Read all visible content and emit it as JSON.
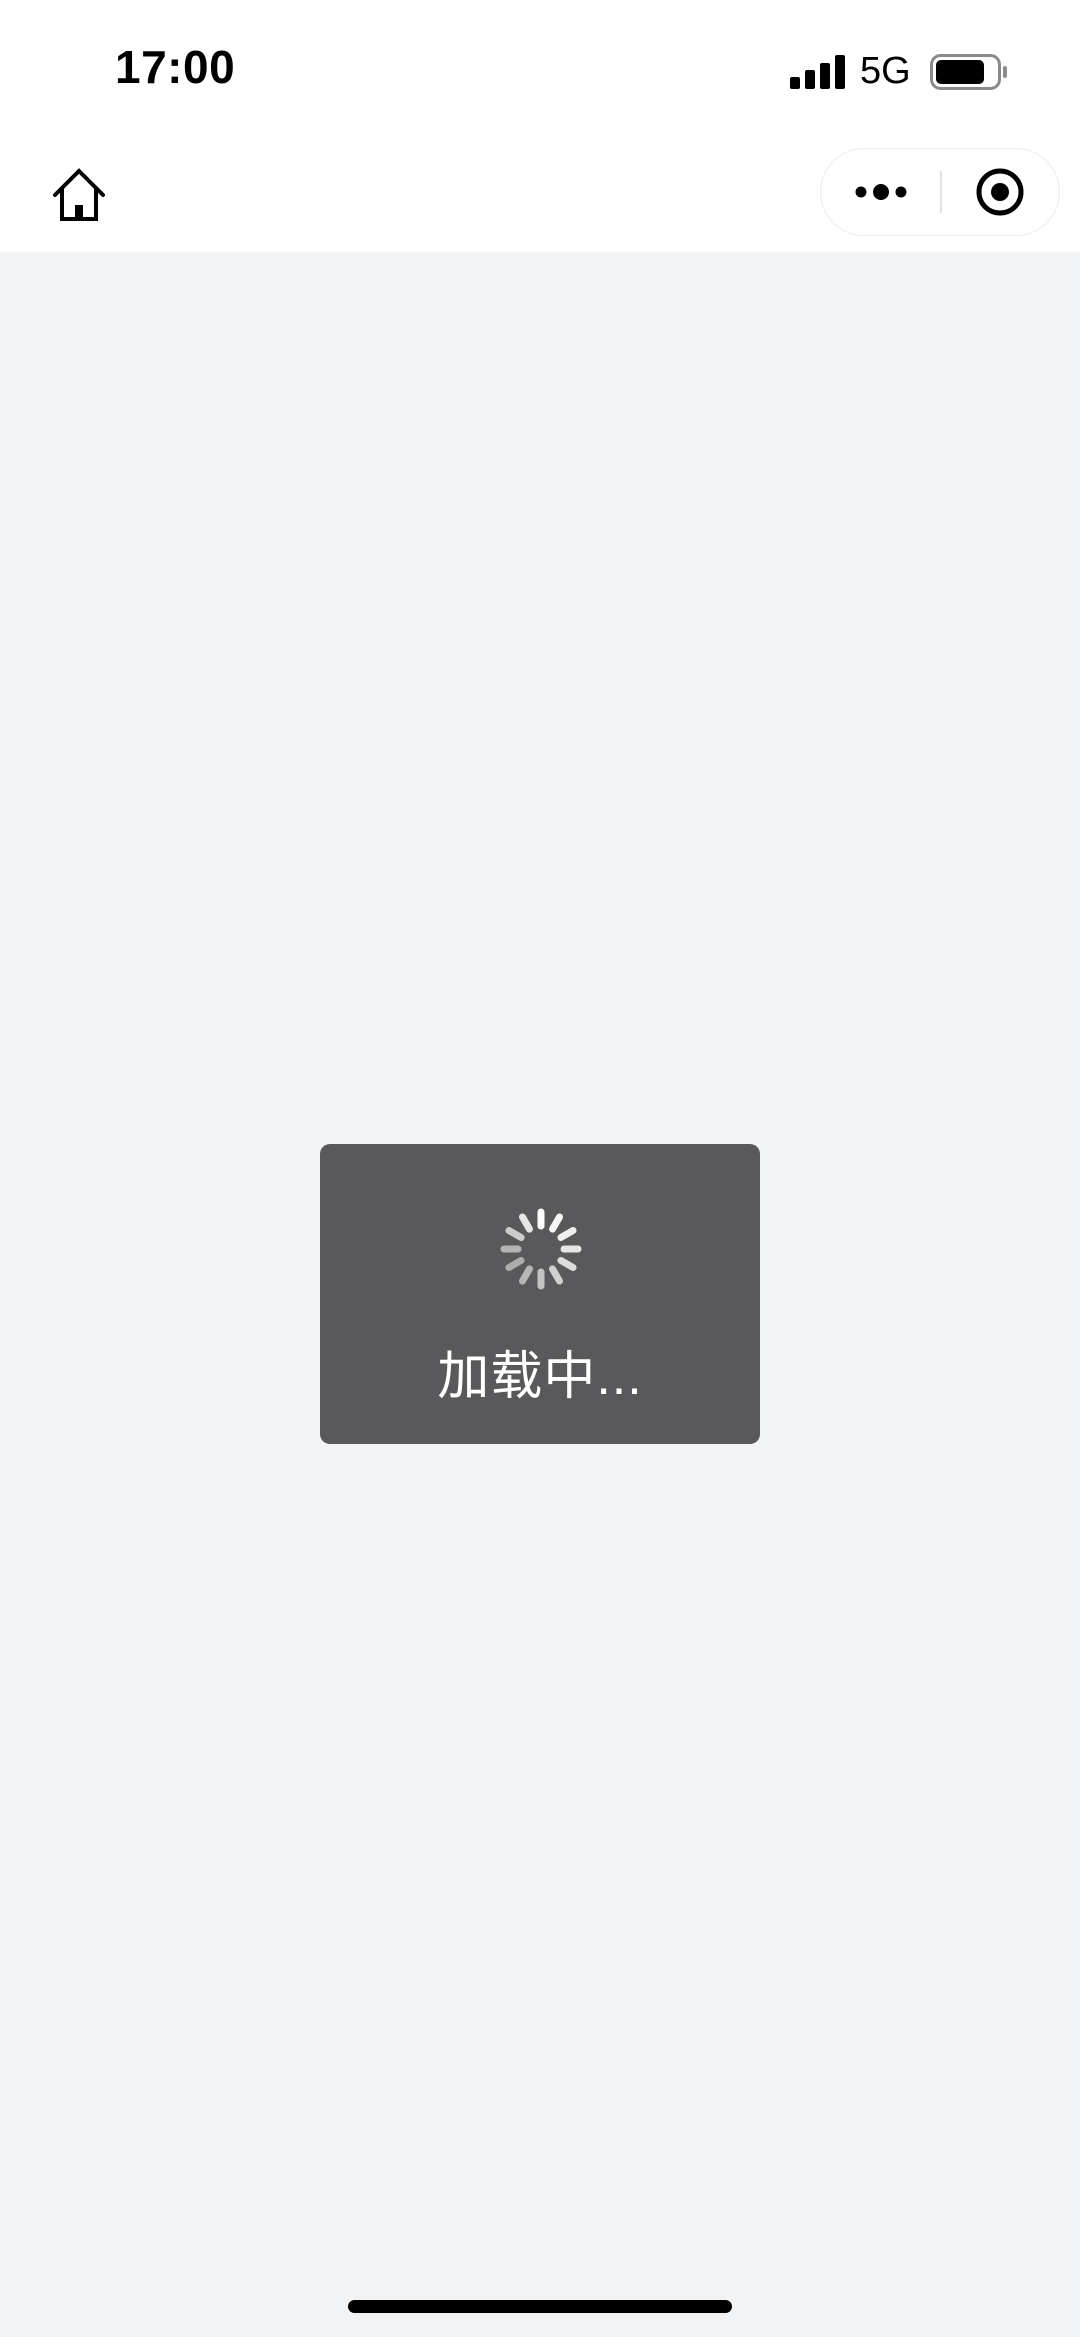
{
  "status_bar": {
    "time": "17:00",
    "network": "5G",
    "signal_icon": "cellular-signal-icon",
    "battery_icon": "battery-icon"
  },
  "nav_bar": {
    "home_icon": "home-icon",
    "more_icon": "more-dots-icon",
    "close_icon": "target-close-icon"
  },
  "loading_toast": {
    "text": "加载中...",
    "icon": "loading-spinner-icon"
  },
  "colors": {
    "page_background": "#f2f3f5",
    "bar_background": "#ffffff",
    "toast_background": "#59595b",
    "toast_text": "#ffffff"
  }
}
